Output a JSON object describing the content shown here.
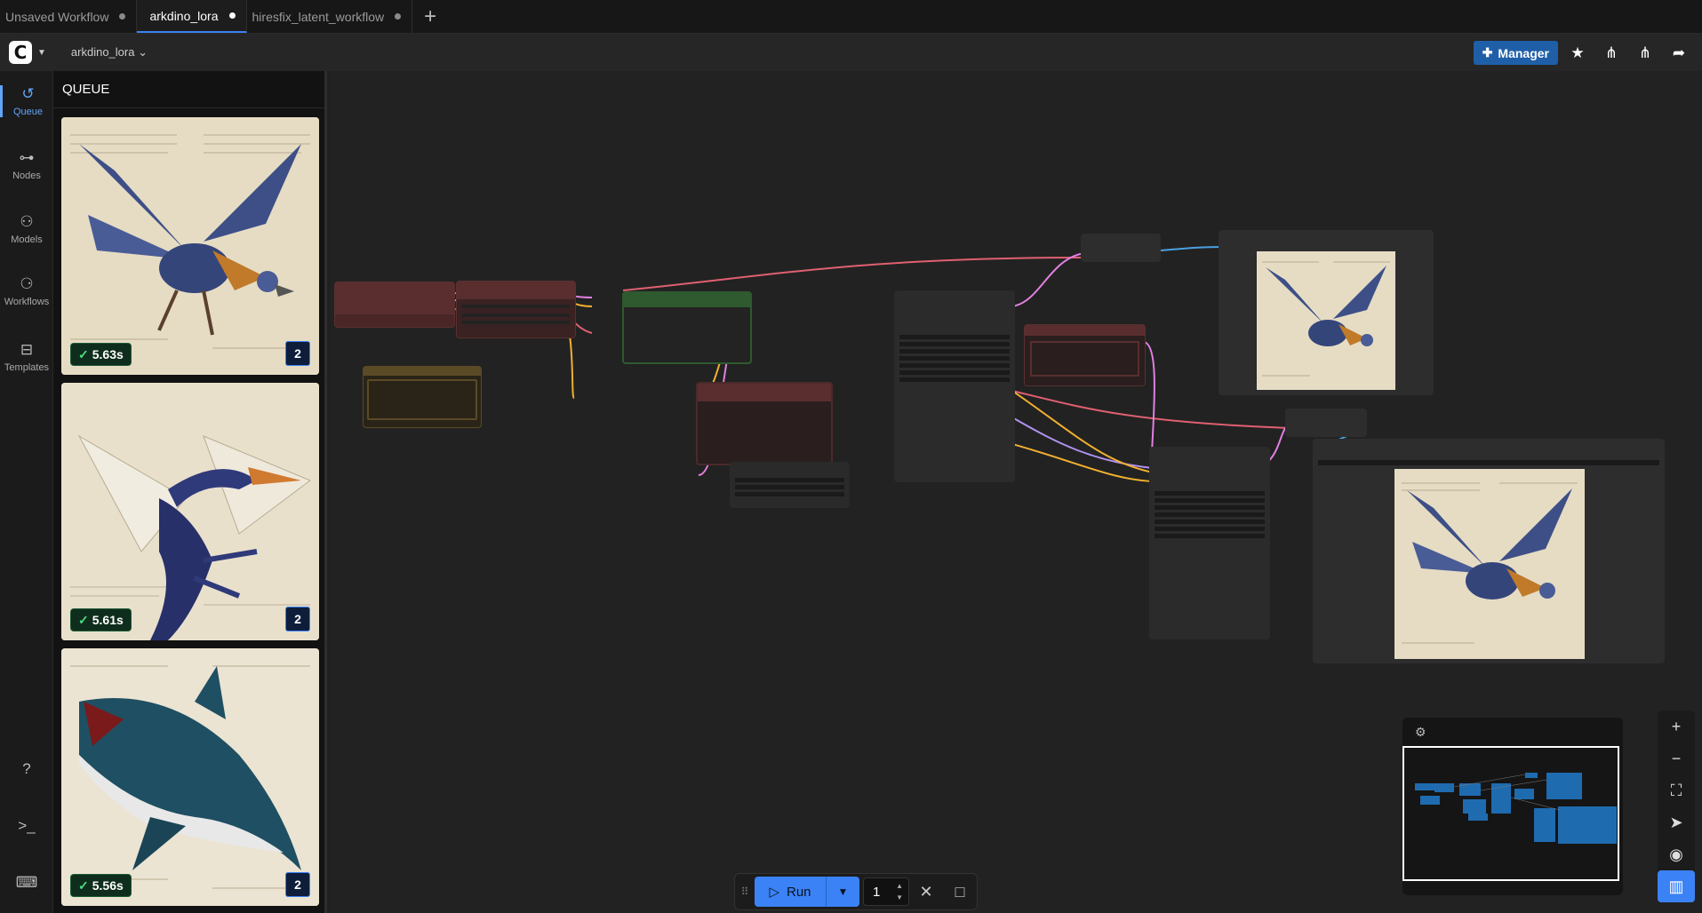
{
  "tabs": [
    {
      "label": "Unsaved Workflow",
      "active": false
    },
    {
      "label": "arkdino_lora",
      "active": true
    },
    {
      "label": "hiresfix_latent_workflow",
      "active": false
    }
  ],
  "menubar": {
    "workflow_name": "arkdino_lora",
    "manager_label": "Manager",
    "icons": [
      "star-icon",
      "node-a-icon",
      "node-b-icon",
      "share-icon"
    ]
  },
  "sidebar": {
    "items": [
      {
        "label": "Queue",
        "icon": "history-icon",
        "active": true
      },
      {
        "label": "Nodes",
        "icon": "nodes-icon",
        "active": false
      },
      {
        "label": "Models",
        "icon": "models-icon",
        "active": false
      },
      {
        "label": "Workflows",
        "icon": "workflows-icon",
        "active": false
      },
      {
        "label": "Templates",
        "icon": "templates-icon",
        "active": false
      }
    ],
    "bottom_icons": [
      "help-icon",
      "terminal-icon",
      "keyboard-icon"
    ]
  },
  "queue": {
    "title": "QUEUE",
    "items": [
      {
        "subject": "blue winged raptor",
        "time": "5.63s",
        "count": "2"
      },
      {
        "subject": "blue pterosaur dragon",
        "time": "5.61s",
        "count": "2"
      },
      {
        "subject": "prehistoric shark",
        "time": "5.56s",
        "count": "2"
      }
    ]
  },
  "runbar": {
    "run_label": "Run",
    "batch_count": "1"
  },
  "colors": {
    "accent": "#3b82f6",
    "node_red": "#5a2e2e",
    "node_green": "#2f5a2f",
    "node_yellow": "#5a4a26",
    "link_red": "#e06070",
    "link_yellow": "#f0b030",
    "link_pink": "#e080e0",
    "link_blue": "#4aa0e0",
    "link_purple": "#b090f0"
  }
}
